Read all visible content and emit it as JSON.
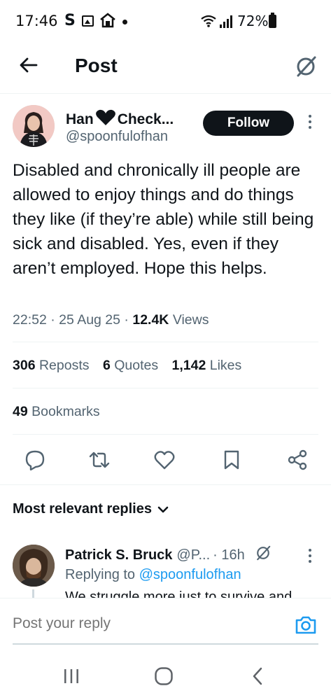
{
  "status_bar": {
    "time": "17:46",
    "notification_letter": "S",
    "battery": "72%"
  },
  "header": {
    "title": "Post"
  },
  "post": {
    "author": {
      "name_left": "Han",
      "name_right": "Check...",
      "handle": "@spoonfulofhan"
    },
    "follow_label": "Follow",
    "text": "Disabled and chronically ill people are allowed to enjoy things and do things they like (if they’re able) while still being sick and disabled. Yes, even if they aren’t employed. Hope this helps.",
    "time": "22:52",
    "date": "25 Aug 25",
    "views_count": "12.4K",
    "views_label": "Views",
    "separator": "·",
    "stats": {
      "reposts_count": "306",
      "reposts_label": "Reposts",
      "quotes_count": "6",
      "quotes_label": "Quotes",
      "likes_count": "1,142",
      "likes_label": "Likes",
      "bookmarks_count": "49",
      "bookmarks_label": "Bookmarks"
    }
  },
  "actions": [
    "reply-icon",
    "repost-icon",
    "like-icon",
    "bookmark-icon",
    "share-icon"
  ],
  "replies": {
    "sort_label": "Most relevant replies",
    "items": [
      {
        "name": "Patrick S. Bruck",
        "handle": "@P...",
        "time": "· 16h",
        "replying_prefix": "Replying to",
        "replying_to": "@spoonfulofhan",
        "text": "We struggle more just to survive and"
      }
    ]
  },
  "compose": {
    "placeholder": "Post your reply"
  },
  "colors": {
    "accent": "#1d9bf0",
    "text_primary": "#0f1419",
    "text_secondary": "#536471",
    "follow_bg": "#0f1419"
  }
}
